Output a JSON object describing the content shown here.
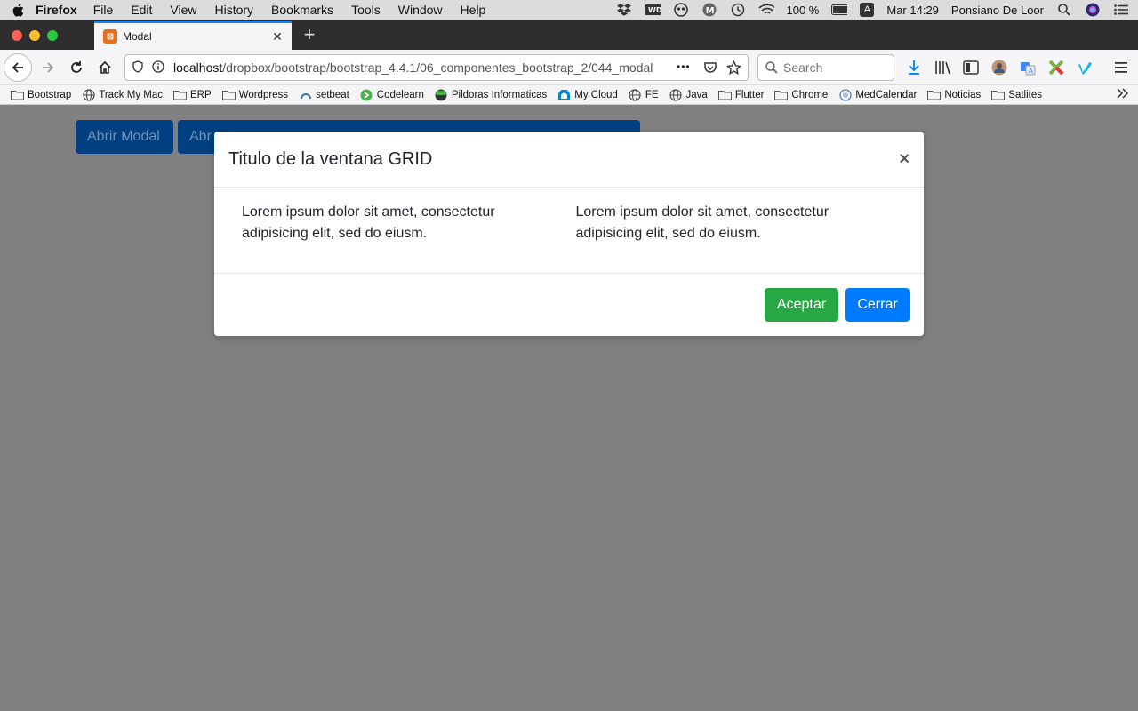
{
  "menubar": {
    "app_name": "Firefox",
    "items": [
      "File",
      "Edit",
      "View",
      "History",
      "Bookmarks",
      "Tools",
      "Window",
      "Help"
    ],
    "battery": "100 %",
    "input_source": "A",
    "clock": "Mar 14:29",
    "user": "Ponsiano De Loor"
  },
  "tab": {
    "title": "Modal",
    "close_glyph": "✕",
    "new_tab_glyph": "+"
  },
  "navbar": {
    "url_host": "localhost",
    "url_path": "/dropbox/bootstrap/bootstrap_4.4.1/06_componentes_bootstrap_2/044_modal",
    "search_placeholder": "Search",
    "more_glyph": "•••"
  },
  "bookmarks": [
    {
      "label": "Bootstrap",
      "icon": "folder-icon"
    },
    {
      "label": "Track My Mac",
      "icon": "globe-icon"
    },
    {
      "label": "ERP",
      "icon": "folder-icon"
    },
    {
      "label": "Wordpress",
      "icon": "folder-icon"
    },
    {
      "label": "setbeat",
      "icon": "setbeat-icon"
    },
    {
      "label": "Codelearn",
      "icon": "codelearn-icon"
    },
    {
      "label": "Pildoras Informaticas",
      "icon": "pildoras-icon"
    },
    {
      "label": "My Cloud",
      "icon": "cloud-icon"
    },
    {
      "label": "FE",
      "icon": "globe-icon"
    },
    {
      "label": "Java",
      "icon": "globe-icon"
    },
    {
      "label": "Flutter",
      "icon": "folder-icon"
    },
    {
      "label": "Chrome",
      "icon": "folder-icon"
    },
    {
      "label": "MedCalendar",
      "icon": "medcalendar-icon"
    },
    {
      "label": "Noticias",
      "icon": "folder-icon"
    },
    {
      "label": "Satlites",
      "icon": "folder-icon"
    }
  ],
  "page": {
    "open_modal_label": "Abrir Modal",
    "open_grid_label": "Abr"
  },
  "modal": {
    "title": "Titulo de la ventana GRID",
    "close_glyph": "×",
    "col1": "Lorem ipsum dolor sit amet, consectetur adipisicing elit, sed do eiusm.",
    "col2": "Lorem ipsum dolor sit amet, consectetur adipisicing elit, sed do eiusm.",
    "accept_label": "Aceptar",
    "close_label": "Cerrar"
  },
  "colors": {
    "accept": "#28a745",
    "primary": "#007bff",
    "backdrop": "#808080",
    "tab_accent": "#0a84ff"
  }
}
